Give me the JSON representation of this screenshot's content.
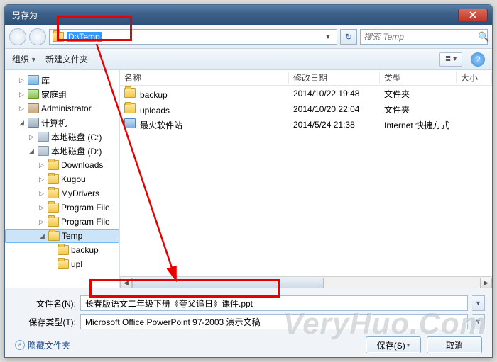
{
  "window": {
    "title": "另存为"
  },
  "path": {
    "text": "D:\\Temp"
  },
  "search": {
    "placeholder": "搜索 Temp"
  },
  "toolbar": {
    "organize": "组织",
    "new_folder": "新建文件夹"
  },
  "columns": {
    "name": "名称",
    "date": "修改日期",
    "type": "类型",
    "size": "大小"
  },
  "tree": {
    "library": "库",
    "homegroup": "家庭组",
    "user": "Administrator",
    "computer": "计算机",
    "drive_c": "本地磁盘 (C:)",
    "drive_d": "本地磁盘 (D:)",
    "downloads": "Downloads",
    "kugou": "Kugou",
    "mydrivers": "MyDrivers",
    "programfiles": "Program File",
    "programfiles2": "Program File",
    "temp": "Temp",
    "backup": "backup",
    "uploads": "upl"
  },
  "files": [
    {
      "name": "backup",
      "date": "2014/10/22 19:48",
      "type": "文件夹",
      "kind": "folder"
    },
    {
      "name": "uploads",
      "date": "2014/10/20 22:04",
      "type": "文件夹",
      "kind": "folder"
    },
    {
      "name": "最火软件站",
      "date": "2014/5/24 21:38",
      "type": "Internet 快捷方式",
      "kind": "web"
    }
  ],
  "filename": {
    "label": "文件名(N):",
    "value": "长春版语文二年级下册《夸父追日》课件.ppt"
  },
  "filetype": {
    "label": "保存类型(T):",
    "value": "Microsoft Office PowerPoint 97-2003 演示文稿"
  },
  "actions": {
    "hide": "隐藏文件夹",
    "save": "保存(S)",
    "cancel": "取消"
  },
  "watermark": "VeryHuo.Com"
}
